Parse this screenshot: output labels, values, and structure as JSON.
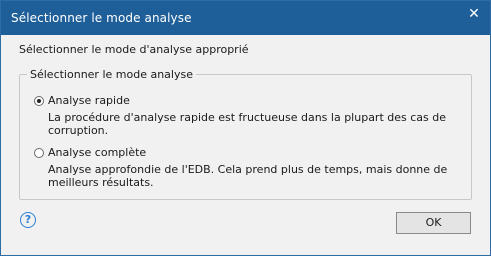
{
  "window": {
    "title": "Sélectionner le mode analyse",
    "close_glyph": "✕"
  },
  "dialog": {
    "instruction": "Sélectionner le mode d'analyse approprié",
    "group_label": "Sélectionner le mode analyse",
    "options": [
      {
        "label": "Analyse rapide",
        "description": "La procédure d'analyse rapide est fructueuse dans la plupart des cas de corruption.",
        "selected": true
      },
      {
        "label": "Analyse complète",
        "description": "Analyse approfondie de l'EDB. Cela prend plus de temps, mais donne de meilleurs résultats.",
        "selected": false
      }
    ],
    "help_glyph": "?",
    "ok_label": "OK"
  },
  "colors": {
    "titlebar": "#1f5f99",
    "background": "#f1f1f1",
    "help_icon": "#2d7fd6"
  }
}
